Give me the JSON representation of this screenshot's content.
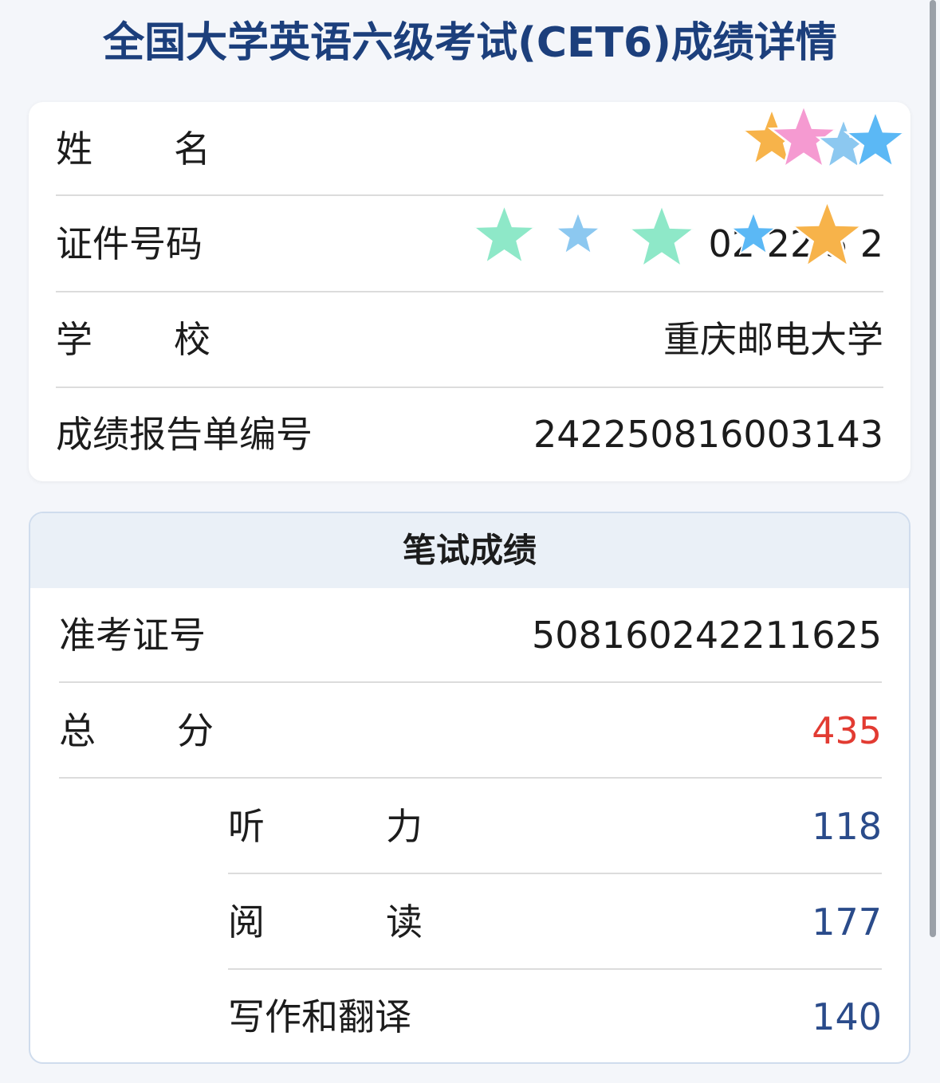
{
  "page": {
    "title": "全国大学英语六级考试(CET6)成绩详情"
  },
  "info": {
    "name_label": "姓名",
    "id_label": "证件号码",
    "id_value_partial": "02 22  5  2",
    "school_label": "学校",
    "school_value": "重庆邮电大学",
    "report_label": "成绩报告单编号",
    "report_value": "242250816003143"
  },
  "score": {
    "header": "笔试成绩",
    "ticket_label": "准考证号",
    "ticket_value": "508160242211625",
    "total_label": "总分",
    "total_value": "435",
    "listening_label": "听力",
    "listening_value": "118",
    "reading_label": "阅读",
    "reading_value": "177",
    "writing_label": "写作和翻译",
    "writing_value": "140"
  },
  "colors": {
    "title": "#1c3f7c",
    "total": "#e23b32",
    "sub_score": "#2a4b8a",
    "header_bg": "#eaf0f7",
    "redaction_stars": [
      "#f7b34a",
      "#f59ad1",
      "#5bb8f5",
      "#8ee8c8"
    ]
  },
  "icons": {
    "redaction": "star-sticker-icon"
  }
}
